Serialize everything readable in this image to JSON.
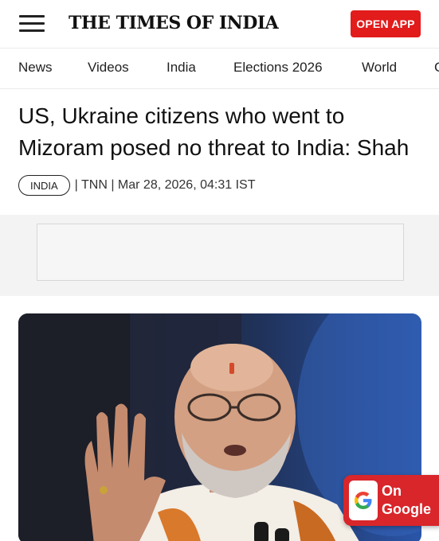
{
  "header": {
    "logo_text": "THE TIMES OF INDIA",
    "open_app_label": "OPEN APP",
    "menu_icon": "hamburger-menu-icon"
  },
  "nav": {
    "items": [
      "News",
      "Videos",
      "India",
      "Elections 2026",
      "World"
    ]
  },
  "article": {
    "headline": "US, Ukraine citizens who went to Mizoram posed no threat to India: Shah",
    "tag": "INDIA",
    "byline": "| TNN | Mar 28, 2026, 04:31 IST"
  },
  "google_badge": {
    "line1": "On",
    "line2": "Google",
    "icon": "google-g-icon"
  },
  "colors": {
    "accent_red": "#e21b1b",
    "badge_red": "#d8262b"
  }
}
